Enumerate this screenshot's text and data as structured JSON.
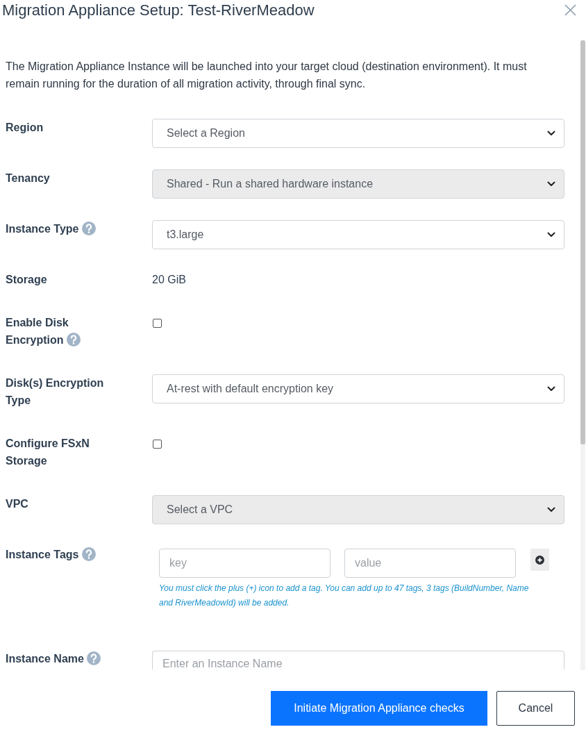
{
  "dialog": {
    "title": "Migration Appliance Setup: Test-RiverMeadow"
  },
  "intro": "The Migration Appliance Instance will be launched into your target cloud (destination environment). It must remain running for the duration of all migration activity, through final sync.",
  "fields": [
    {
      "kind": "select",
      "label": "Region",
      "help": false,
      "value": "Select a Region",
      "disabled": false
    },
    {
      "kind": "select",
      "label": "Tenancy",
      "help": false,
      "value": "Shared - Run a shared hardware instance",
      "disabled": true
    },
    {
      "kind": "select",
      "label": "Instance Type",
      "help": true,
      "value": "t3.large",
      "disabled": false
    },
    {
      "kind": "text",
      "label": "Storage",
      "help": false,
      "value": "20 GiB"
    },
    {
      "kind": "checkbox",
      "label": "Enable Disk Encryption",
      "help": true,
      "checked": false
    },
    {
      "kind": "select",
      "label": "Disk(s) Encryption Type",
      "help": false,
      "value": "At-rest with default encryption key",
      "disabled": false
    },
    {
      "kind": "checkbox",
      "label": "Configure FSxN Storage",
      "help": false,
      "checked": false
    },
    {
      "kind": "select",
      "label": "VPC",
      "help": false,
      "value": "Select a VPC",
      "disabled": true
    },
    {
      "kind": "tags",
      "label": "Instance Tags",
      "help": true,
      "key_placeholder": "key",
      "value_placeholder": "value",
      "note": "You must click the plus (+) icon to add a tag. You can add up to 47 tags, 3 tags (BuildNumber, Name and RiverMeadowId) will be added."
    },
    {
      "kind": "input",
      "label": "Instance Name",
      "help": true,
      "placeholder": "Enter an Instance Name"
    }
  ],
  "buttons": [
    {
      "kind": "primary",
      "label": "Initiate Migration Appliance checks"
    },
    {
      "kind": "secondary",
      "label": "Cancel"
    }
  ]
}
